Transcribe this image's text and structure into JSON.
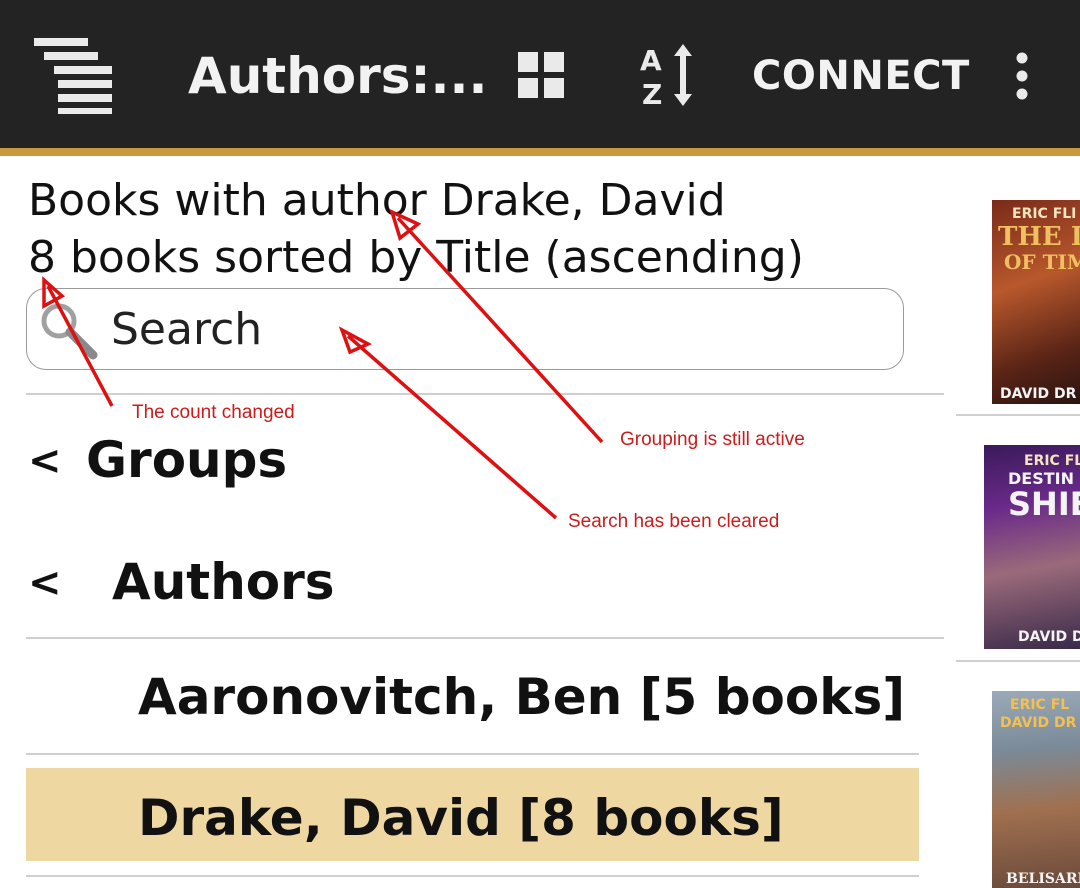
{
  "appbar": {
    "title": "Authors:...",
    "connect_label": "CONNECT",
    "icons": [
      "menu-icon",
      "grid-view-icon",
      "sort-az-icon",
      "overflow-menu-icon"
    ],
    "accent_color": "#c89a3c",
    "bar_color": "#232323"
  },
  "header": {
    "line1": "Books with author Drake, David",
    "line2": "8 books sorted by Title (ascending)"
  },
  "search": {
    "placeholder": "Search",
    "value": ""
  },
  "list": {
    "groups_chevron": "<",
    "groups_label": "Groups",
    "authors_chevron": "<",
    "authors_label": "Authors",
    "items": [
      {
        "label": "Aaronovitch, Ben [5 books]",
        "selected": false
      },
      {
        "label": "Drake, David [8 books]",
        "selected": true
      }
    ],
    "selected_color": "#efd7a1"
  },
  "covers": [
    {
      "top": "ERIC FLI",
      "title_a": "THE DAN",
      "title_b": "OF TIM",
      "bottom": "DAVID DR"
    },
    {
      "top": "ERIC FLI",
      "title_a": "DESTIN",
      "title_b": "SHIEL",
      "bottom": "DAVID DRA"
    },
    {
      "top": "ERIC FL",
      "title_a": "DAVID DR",
      "title_b": "",
      "bottom": "BELISARIU"
    }
  ],
  "annotations": {
    "count_changed": "The count changed",
    "grouping_active": "Grouping is still active",
    "search_cleared": "Search has been cleared",
    "color": "#cc1b1b"
  }
}
